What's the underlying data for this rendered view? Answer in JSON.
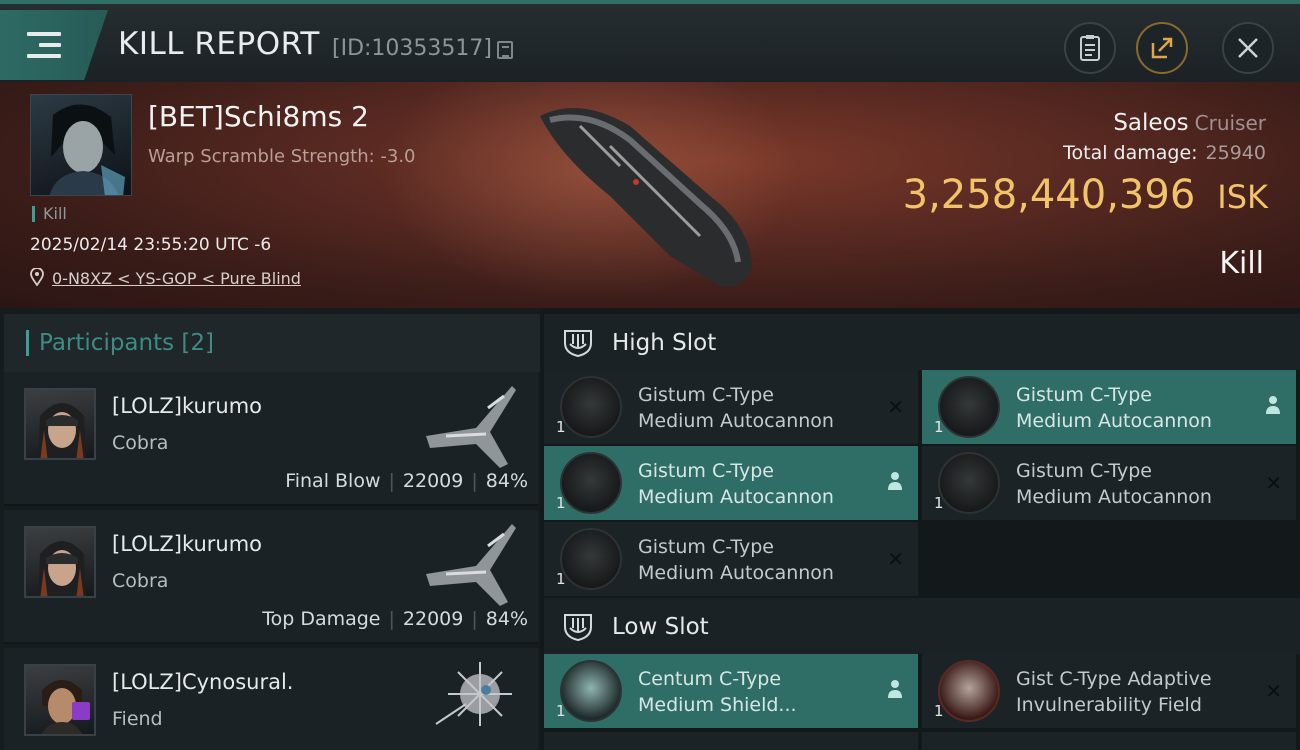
{
  "header": {
    "title": "KILL REPORT",
    "report_id": "[ID:10353517]"
  },
  "victim": {
    "name": "[BET]Schi8ms 2",
    "subtitle": "Warp Scramble Strength: -3.0",
    "tag": "Kill",
    "datetime": "2025/02/14 23:55:20 UTC -6",
    "location": "0-N8XZ < YS-GOP < Pure Blind",
    "ship_name": "Saleos",
    "ship_class": "Cruiser",
    "total_damage_label": "Total damage:",
    "total_damage": "25940",
    "isk_value": "3,258,440,396",
    "isk_unit": "ISK",
    "outcome": "Kill"
  },
  "participants": {
    "label": "Participants",
    "count": "[2]",
    "items": [
      {
        "name": "[LOLZ]kurumo",
        "ship": "Cobra",
        "role": "Final Blow",
        "damage": "22009",
        "percent": "84%"
      },
      {
        "name": "[LOLZ]kurumo",
        "ship": "Cobra",
        "role": "Top Damage",
        "damage": "22009",
        "percent": "84%"
      },
      {
        "name": "[LOLZ]Cynosural.",
        "ship": "Fiend",
        "role": "",
        "damage": "",
        "percent": ""
      }
    ]
  },
  "slots": {
    "high": {
      "label": "High Slot",
      "modules": [
        {
          "line1": "Gistum C-Type",
          "line2": "Medium Autocannon",
          "qty": "1",
          "state": "destroyed"
        },
        {
          "line1": "Gistum C-Type",
          "line2": "Medium Autocannon",
          "qty": "1",
          "state": "dropped"
        },
        {
          "line1": "Gistum C-Type",
          "line2": "Medium Autocannon",
          "qty": "1",
          "state": "dropped"
        },
        {
          "line1": "Gistum C-Type",
          "line2": "Medium Autocannon",
          "qty": "1",
          "state": "destroyed"
        },
        {
          "line1": "Gistum C-Type",
          "line2": "Medium Autocannon",
          "qty": "1",
          "state": "destroyed"
        }
      ]
    },
    "low": {
      "label": "Low Slot",
      "modules": [
        {
          "line1": "Centum C-Type",
          "line2": "Medium Shield...",
          "qty": "1",
          "state": "dropped"
        },
        {
          "line1": "Gist C-Type Adaptive",
          "line2": "Invulnerability Field",
          "qty": "1",
          "state": "destroyed"
        }
      ]
    }
  },
  "colors": {
    "accent": "#2f6e66",
    "isk": "#f2c46a",
    "banner": "#5a2a22"
  },
  "icons": {
    "state_destroyed": "✕",
    "state_dropped": "person-icon"
  }
}
